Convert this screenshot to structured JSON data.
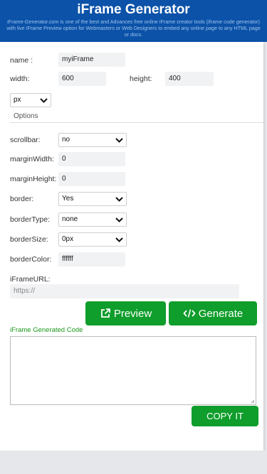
{
  "header": {
    "title": "iFrame Generator",
    "description": "iFrame-Generator.com is one of the best and Advances free online iFrame creator tools (iframe code generator) with live iFrame Preview option for Webmasters or Web Designers to embed any online page to any HTML page or docs."
  },
  "form": {
    "name_label": "name :",
    "name_value": "myiFrame",
    "width_label": "width:",
    "width_value": "600",
    "height_label": "height:",
    "height_value": "400",
    "unit_value": "px",
    "options_legend": "Options",
    "scrollbar_label": "scrollbar:",
    "scrollbar_value": "no",
    "marginwidth_label": "marginWidth:",
    "marginwidth_value": "0",
    "marginheight_label": "marginHeight:",
    "marginheight_value": "0",
    "border_label": "border:",
    "border_value": "Yes",
    "bordertype_label": "borderType:",
    "bordertype_value": "none",
    "bordersize_label": "borderSize:",
    "bordersize_value": "0px",
    "bordercolor_label": "borderColor:",
    "bordercolor_value": "ffffff",
    "url_label": "iFrameURL:",
    "url_placeholder": "https://"
  },
  "actions": {
    "preview_label": "Preview",
    "generate_label": "Generate",
    "copy_label": "COPY IT"
  },
  "output": {
    "label": "iFrame Generated Code",
    "value": ""
  },
  "icons": {
    "preview": "external-link-icon",
    "generate": "code-icon",
    "select": "chevron-down-icon"
  },
  "colors": {
    "header_bg": "#0b52a8",
    "button_green": "#0f9d2b",
    "generated_label": "#1a9a1a"
  }
}
